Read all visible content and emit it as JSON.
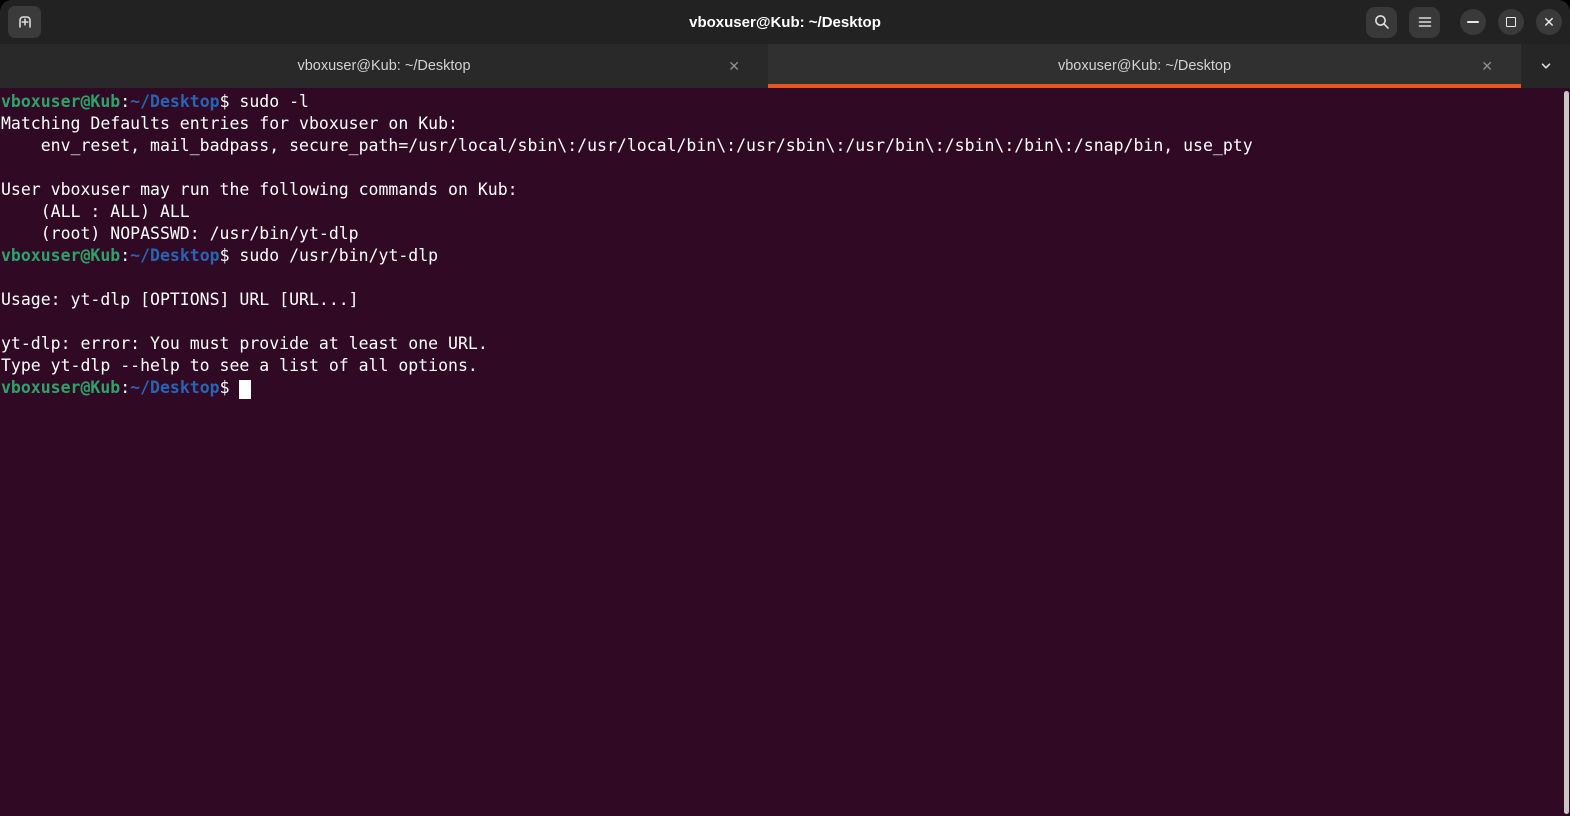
{
  "window": {
    "title": "vboxuser@Kub: ~/Desktop"
  },
  "tabbar": {
    "tabs": [
      {
        "label": "vboxuser@Kub: ~/Desktop",
        "active": false
      },
      {
        "label": "vboxuser@Kub: ~/Desktop",
        "active": true
      }
    ]
  },
  "icons": {
    "new_tab": "tab-new-icon",
    "search": "search-icon",
    "menu": "hamburger-menu-icon",
    "minimize": "minimize-icon",
    "maximize": "maximize-icon",
    "close": "close-icon",
    "tab_close_glyph": "✕",
    "chevron": "chevron-down-icon"
  },
  "colors": {
    "terminal_background": "#300A24",
    "terminal_foreground": "#FFFFFF",
    "prompt_user_green": "#2DA269",
    "prompt_path_blue": "#2864B4",
    "active_tab_accent": "#E9541F"
  },
  "terminal": {
    "lines": [
      {
        "segments": [
          {
            "t": "vboxuser@Kub",
            "c": "green"
          },
          {
            "t": ":",
            "c": "fg"
          },
          {
            "t": "~/Desktop",
            "c": "blue"
          },
          {
            "t": "$ sudo -l",
            "c": "fg"
          }
        ]
      },
      {
        "segments": [
          {
            "t": "Matching Defaults entries for vboxuser on Kub:",
            "c": "fg"
          }
        ]
      },
      {
        "segments": [
          {
            "t": "    env_reset, mail_badpass, secure_path=/usr/local/sbin\\:/usr/local/bin\\:/usr/sbin\\:/usr/bin\\:/sbin\\:/bin\\:/snap/bin, use_pty",
            "c": "fg"
          }
        ]
      },
      {
        "segments": []
      },
      {
        "segments": [
          {
            "t": "User vboxuser may run the following commands on Kub:",
            "c": "fg"
          }
        ]
      },
      {
        "segments": [
          {
            "t": "    (ALL : ALL) ALL",
            "c": "fg"
          }
        ]
      },
      {
        "segments": [
          {
            "t": "    (root) NOPASSWD: /usr/bin/yt-dlp",
            "c": "fg"
          }
        ]
      },
      {
        "segments": [
          {
            "t": "vboxuser@Kub",
            "c": "green"
          },
          {
            "t": ":",
            "c": "fg"
          },
          {
            "t": "~/Desktop",
            "c": "blue"
          },
          {
            "t": "$ sudo /usr/bin/yt-dlp",
            "c": "fg"
          }
        ]
      },
      {
        "segments": []
      },
      {
        "segments": [
          {
            "t": "Usage: yt-dlp [OPTIONS] URL [URL...]",
            "c": "fg"
          }
        ]
      },
      {
        "segments": []
      },
      {
        "segments": [
          {
            "t": "yt-dlp: error: You must provide at least one URL.",
            "c": "fg"
          }
        ]
      },
      {
        "segments": [
          {
            "t": "Type yt-dlp --help to see a list of all options.",
            "c": "fg"
          }
        ]
      },
      {
        "segments": [
          {
            "t": "vboxuser@Kub",
            "c": "green"
          },
          {
            "t": ":",
            "c": "fg"
          },
          {
            "t": "~/Desktop",
            "c": "blue"
          },
          {
            "t": "$ ",
            "c": "fg"
          }
        ],
        "cursor": true
      }
    ]
  }
}
